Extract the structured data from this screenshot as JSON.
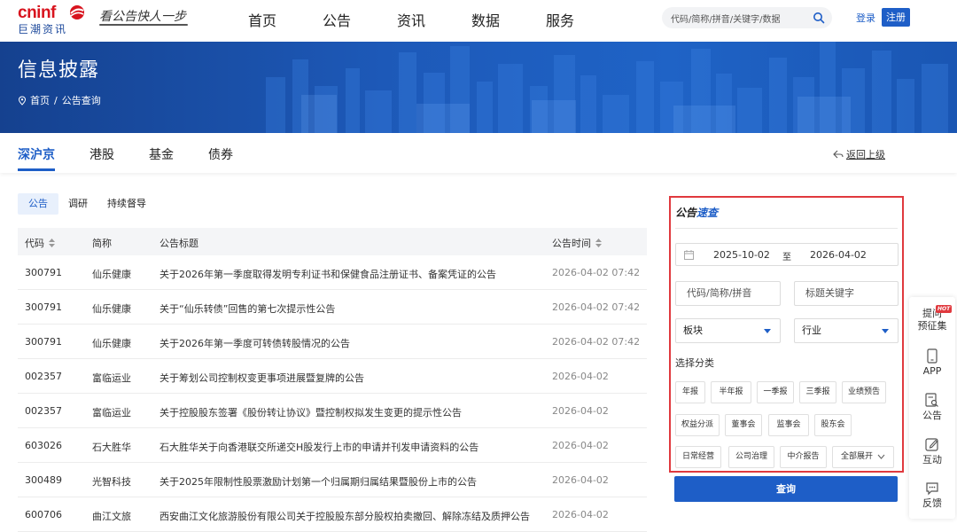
{
  "header": {
    "logo_main": "cninf",
    "logo_sub": "巨潮资讯",
    "slogan": "看公告快人一步",
    "nav": [
      "首页",
      "公告",
      "资讯",
      "数据",
      "服务"
    ],
    "search_placeholder": "代码/简称/拼音/关键字/数据",
    "login": "登录",
    "register": "注册",
    "brand_color": "#d8141e",
    "accent_color": "#1e5ec7"
  },
  "banner": {
    "title": "信息披露",
    "breadcrumb": [
      "首页",
      "公告查询"
    ],
    "breadcrumb_sep": "/"
  },
  "market_tabs": [
    "深沪京",
    "港股",
    "基金",
    "债券"
  ],
  "active_market_tab": "深沪京",
  "back_link": "返回上级",
  "sub_tabs": [
    "公告",
    "调研",
    "持续督导"
  ],
  "active_sub_tab": "公告",
  "table": {
    "columns": [
      "代码",
      "简称",
      "公告标题",
      "公告时间"
    ],
    "rows": [
      {
        "code": "300791",
        "name": "仙乐健康",
        "title": "关于2026年第一季度取得发明专利证书和保健食品注册证书、备案凭证的公告",
        "time": "2026-04-02 07:42"
      },
      {
        "code": "300791",
        "name": "仙乐健康",
        "title": "关于“仙乐转债”回售的第七次提示性公告",
        "time": "2026-04-02 07:42"
      },
      {
        "code": "300791",
        "name": "仙乐健康",
        "title": "关于2026年第一季度可转债转股情况的公告",
        "time": "2026-04-02 07:42"
      },
      {
        "code": "002357",
        "name": "富临运业",
        "title": "关于筹划公司控制权变更事项进展暨复牌的公告",
        "time": "2026-04-02"
      },
      {
        "code": "002357",
        "name": "富临运业",
        "title": "关于控股股东签署《股份转让协议》暨控制权拟发生变更的提示性公告",
        "time": "2026-04-02"
      },
      {
        "code": "603026",
        "name": "石大胜华",
        "title": "石大胜华关于向香港联交所递交H股发行上市的申请并刊发申请资料的公告",
        "time": "2026-04-02"
      },
      {
        "code": "300489",
        "name": "光智科技",
        "title": "关于2025年限制性股票激励计划第一个归属期归属结果暨股份上市的公告",
        "time": "2026-04-02"
      },
      {
        "code": "600706",
        "name": "曲江文旅",
        "title": "西安曲江文化旅游股份有限公司关于控股股东部分股权拍卖撤回、解除冻结及质押公告",
        "time": "2026-04-02"
      }
    ]
  },
  "quick_search": {
    "title_plain": "公告",
    "title_highlight": "速查",
    "date_start": "2025-10-02",
    "date_to": "至",
    "date_end": "2026-04-02",
    "code_placeholder": "代码/简称/拼音",
    "keyword_placeholder": "标题关键字",
    "sector_select": "板块",
    "industry_select": "行业",
    "category_label": "选择分类",
    "categories": [
      "年报",
      "半年报",
      "一季报",
      "三季报",
      "业绩预告",
      "权益分派",
      "董事会",
      "监事会",
      "股东会",
      "日常经营",
      "公司治理",
      "中介报告",
      "全部展开"
    ],
    "query_button": "查询"
  },
  "float_bar": {
    "items": [
      "提问\n预征集",
      "APP",
      "公告",
      "互动",
      "反馈"
    ],
    "hot_badge": "HOT"
  }
}
